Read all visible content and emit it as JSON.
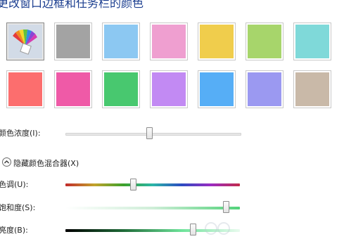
{
  "title": "更改窗口边框和任务栏的颜色",
  "colors": {
    "row1": [
      "#cfd9e6",
      "#a3a3a3",
      "#8cc8f2",
      "#ef9fd0",
      "#f0cd4c",
      "#a7d56b",
      "#7fd9d9"
    ],
    "row2": [
      "#fc6e6e",
      "#ef5aa7",
      "#48c86f",
      "#c28af3",
      "#56aef6",
      "#9b99f1",
      "#c9b9a8"
    ]
  },
  "intensity": {
    "label": "颜色浓度(I):",
    "value_pct": 48
  },
  "mixer": {
    "toggle_label": "隐藏颜色混合器(X)",
    "hue": {
      "label": "色调(U):",
      "value_pct": 39
    },
    "saturation": {
      "label": "饱和度(S):",
      "value_pct": 92
    },
    "brightness": {
      "label": "亮度(B):",
      "value_pct": 73
    }
  }
}
